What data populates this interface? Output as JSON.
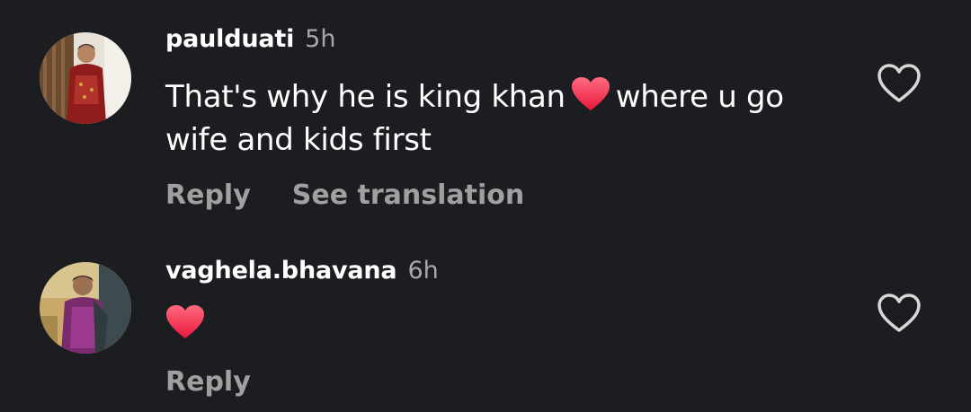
{
  "comments": [
    {
      "username": "paulduati",
      "time": "5h",
      "text_before": "That's why he is king khan",
      "emoji": "heart-emoji",
      "text_after": "where u go wife and kids first",
      "actions": {
        "reply": "Reply",
        "translate": "See translation"
      },
      "like_icon": "heart-outline-icon"
    },
    {
      "username": "vaghela.bhavana",
      "time": "6h",
      "emoji": "heart-emoji",
      "actions": {
        "reply": "Reply"
      },
      "like_icon": "heart-outline-icon"
    }
  ],
  "colors": {
    "background": "#1c1d21",
    "username": "#ffffff",
    "secondary_text": "#a8a8a8",
    "emoji_heart": "#f2304b"
  }
}
